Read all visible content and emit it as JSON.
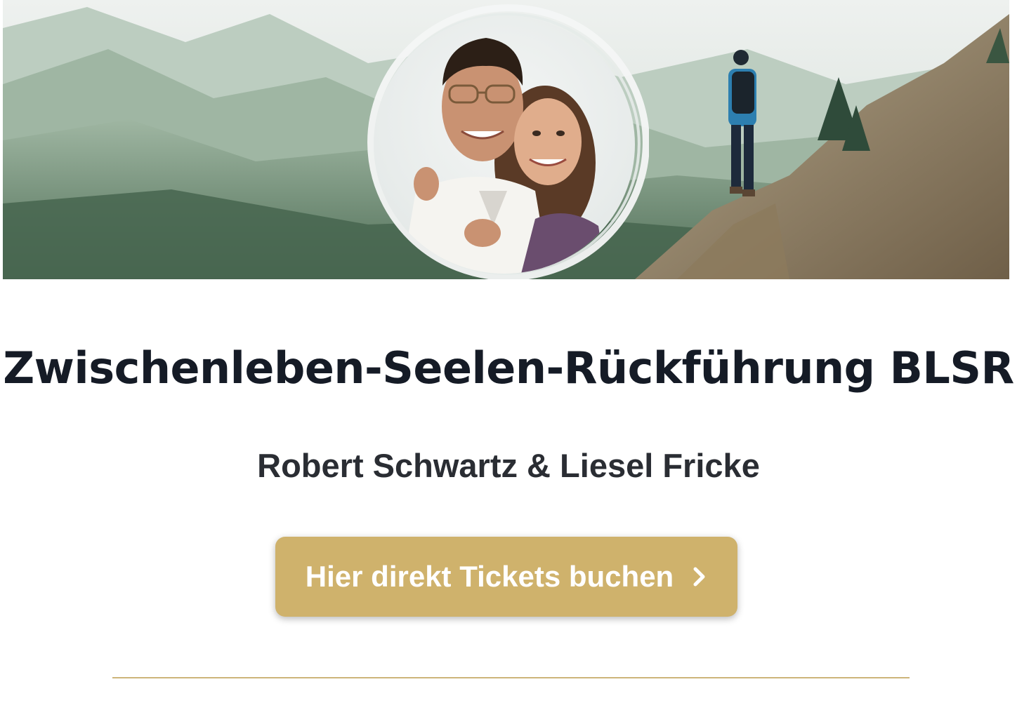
{
  "hero": {
    "image_alt": "mountain hiking banner",
    "portrait_alt": "portrait of two people"
  },
  "title": "Zwischenleben-Seelen-Rückführung BLSR",
  "subtitle": "Robert Schwartz & Liesel Fricke",
  "cta": {
    "label": "Hier direkt Tickets buchen",
    "icon": "chevron-right-icon"
  },
  "colors": {
    "title": "#151b26",
    "subtitle": "#2a2d33",
    "button": "#cfb26c",
    "divider": "#cdb57a"
  }
}
